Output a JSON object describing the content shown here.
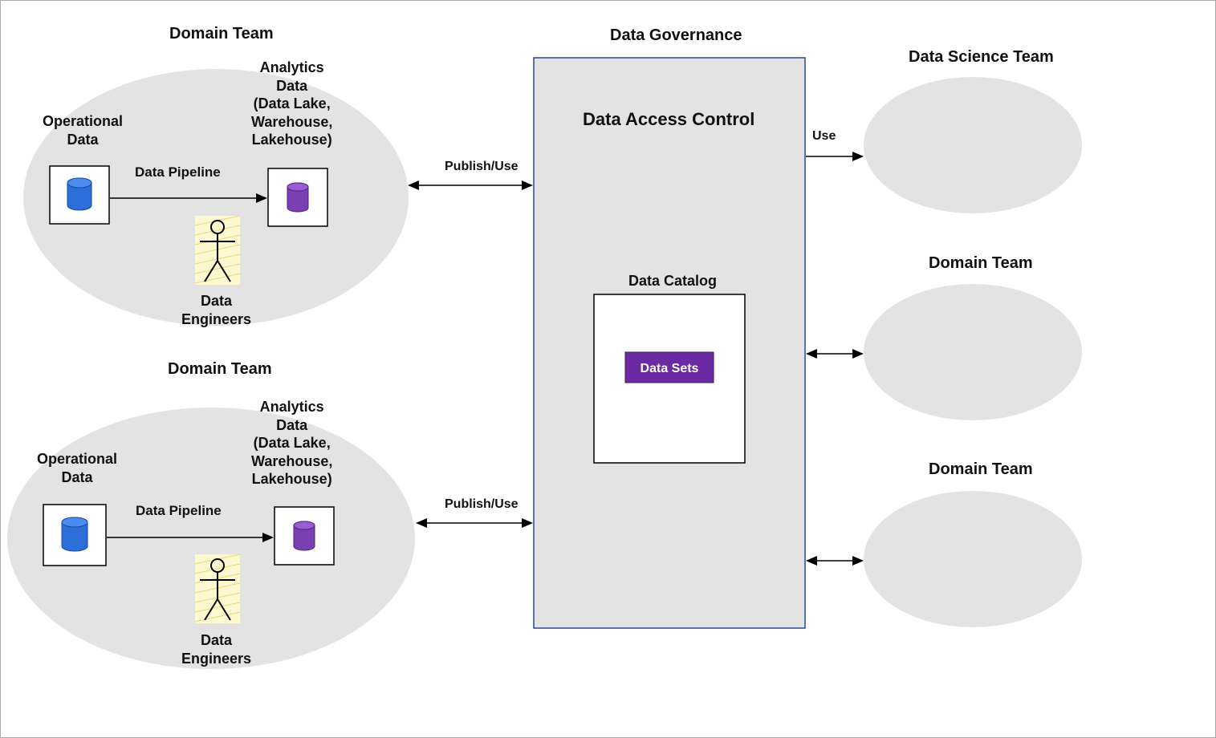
{
  "titles": {
    "domain_team_1": "Domain Team",
    "domain_team_2": "Domain Team",
    "data_governance": "Data Governance",
    "data_science_team": "Data Science Team",
    "right_domain_team_1": "Domain Team",
    "right_domain_team_2": "Domain Team"
  },
  "labels": {
    "operational_data": "Operational\nData",
    "analytics_data": "Analytics\nData\n(Data Lake,\nWarehouse,\nLakehouse)",
    "data_pipeline": "Data Pipeline",
    "data_engineers": "Data\nEngineers",
    "publish_use": "Publish/Use",
    "use": "Use",
    "data_access_control": "Data Access Control",
    "data_catalog": "Data Catalog",
    "data_sets": "Data Sets"
  },
  "icons": {
    "db_operational": "database-icon",
    "db_analytics": "database-icon",
    "stick_figure": "person-icon"
  },
  "colors": {
    "ellipse_fill": "#e3e3e3",
    "gov_stroke": "#2a4a8a",
    "db_op_fill": "#2d6fd8",
    "db_an_fill": "#7a3fb3",
    "datasets_fill": "#6b2aa3"
  }
}
